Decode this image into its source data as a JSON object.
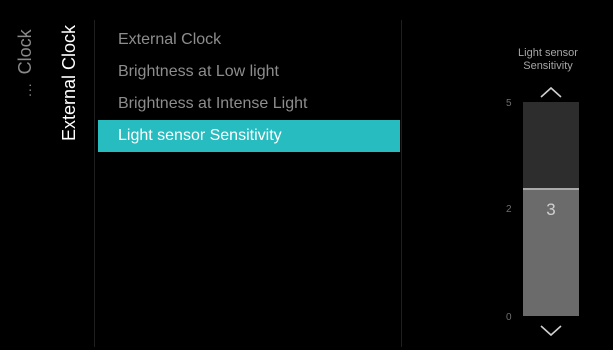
{
  "breadcrumb": {
    "parent": "Clock",
    "ellipsis": "...",
    "current": "External Clock"
  },
  "menu": {
    "items": [
      {
        "label": "External Clock"
      },
      {
        "label": "Brightness at Low light"
      },
      {
        "label": "Brightness at Intense Light"
      },
      {
        "label": "Light sensor Sensitivity"
      }
    ],
    "selected_index": 3
  },
  "slider": {
    "title": "Light sensor Sensitivity",
    "max_label": "5",
    "mid_label": "2",
    "min_label": "0",
    "value": 3,
    "min": 0,
    "max": 5,
    "up_icon": "chevron-up-icon",
    "down_icon": "chevron-down-icon"
  },
  "colors": {
    "background": "#000000",
    "accent": "#26bcc0",
    "text_dim": "#8d8d8d",
    "text_active": "#ffffff",
    "track": "#2d2d2d",
    "fill": "#6b6b6b"
  }
}
